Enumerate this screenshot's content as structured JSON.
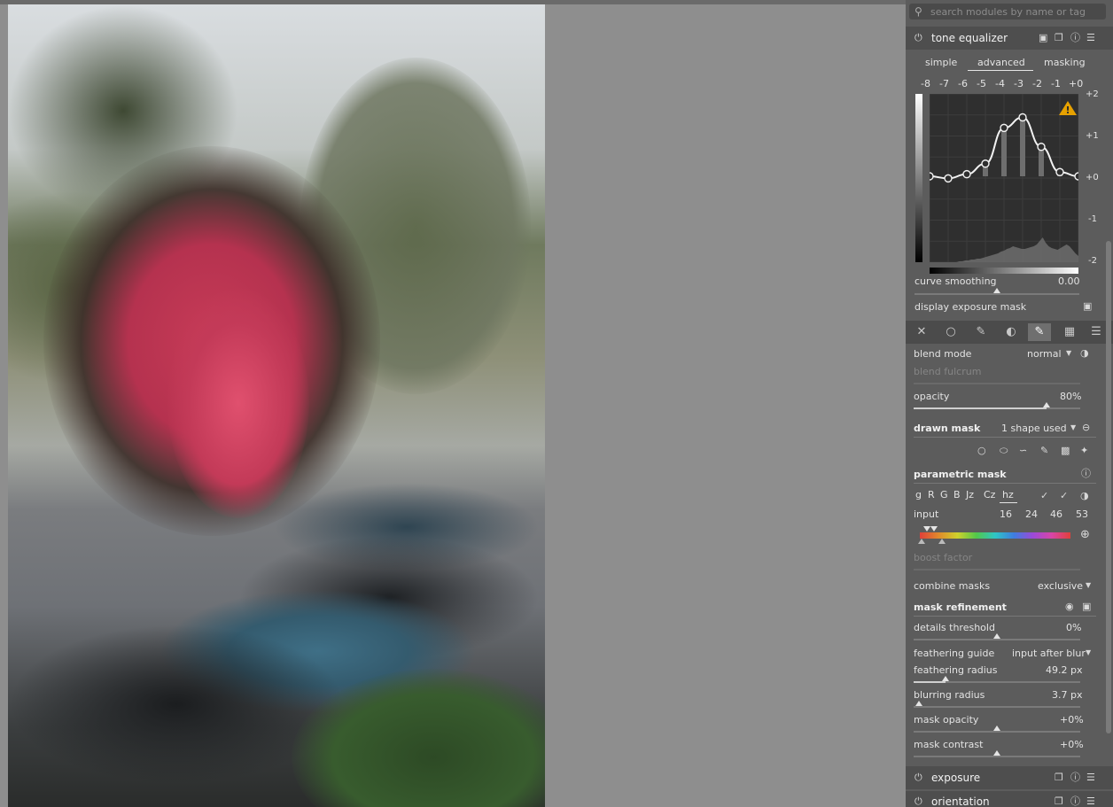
{
  "search": {
    "placeholder": "search modules by name or tag"
  },
  "tone_equalizer": {
    "title": "tone equalizer",
    "tabs": [
      "simple",
      "advanced",
      "masking"
    ],
    "active_tab": "advanced",
    "ev_labels": [
      "-8",
      "-7",
      "-6",
      "-5",
      "-4",
      "-3",
      "-2",
      "-1",
      "+0"
    ],
    "y_labels": [
      "+2",
      "+1",
      "+0",
      "-1",
      "-2"
    ],
    "node_values_ev": [
      0,
      -0.05,
      0.05,
      0.3,
      1.15,
      1.4,
      0.7,
      0.1,
      0
    ],
    "curve_smoothing": {
      "label": "curve smoothing",
      "value": "0.00"
    },
    "display_exposure_mask": {
      "label": "display exposure mask"
    }
  },
  "blend": {
    "blend_mode": {
      "label": "blend mode",
      "value": "normal"
    },
    "blend_fulcrum": {
      "label": "blend fulcrum"
    },
    "opacity": {
      "label": "opacity",
      "value": "80%",
      "level": 0.8
    },
    "drawn_mask": {
      "label": "drawn mask",
      "value": "1 shape used"
    },
    "parametric_mask": {
      "label": "parametric mask",
      "channels": [
        "g",
        "R",
        "G",
        "B",
        "Jz",
        "Cz",
        "hz"
      ],
      "active_channel": "hz",
      "input_label": "input",
      "input_values": [
        "16",
        "24",
        "46",
        "53"
      ]
    },
    "boost_factor": {
      "label": "boost factor"
    },
    "combine_masks": {
      "label": "combine masks",
      "value": "exclusive"
    },
    "mask_refinement": {
      "label": "mask refinement"
    },
    "details_threshold": {
      "label": "details threshold",
      "value": "0%"
    },
    "feathering_guide": {
      "label": "feathering guide",
      "value": "input after blur"
    },
    "feathering_radius": {
      "label": "feathering radius",
      "value": "49.2 px",
      "level": 0.2
    },
    "blurring_radius": {
      "label": "blurring radius",
      "value": "3.7 px",
      "level": 0.03
    },
    "mask_opacity": {
      "label": "mask opacity",
      "value": "+0%",
      "level": 0.5
    },
    "mask_contrast": {
      "label": "mask contrast",
      "value": "+0%",
      "level": 0.5
    }
  },
  "modules_below": [
    "exposure",
    "orientation"
  ],
  "colors": {
    "panel_bg": "#5c5c5c",
    "warning": "#e6a100",
    "center_bg": "#8e8e8e"
  }
}
